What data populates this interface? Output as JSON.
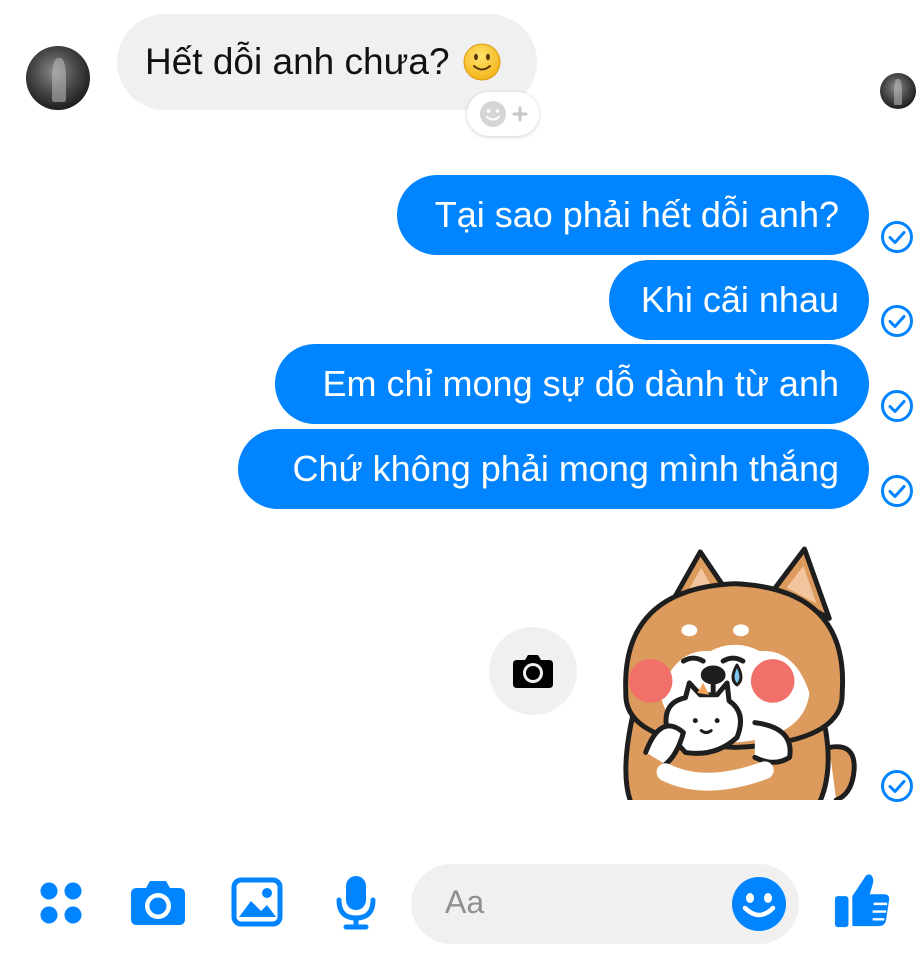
{
  "thread": {
    "received": {
      "text": "Hết dỗi anh chưa?",
      "emoji": "slightly-smiling-face",
      "reaction_button": "add-reaction-icon"
    },
    "sent": [
      {
        "text": "Tại sao phải hết dỗi anh?",
        "status": "sent-check-icon"
      },
      {
        "text": "Khi cãi nhau",
        "status": "sent-check-icon"
      },
      {
        "text": "Em chỉ mong sự dỗ dành từ anh",
        "status": "sent-check-icon"
      },
      {
        "text": "Chứ không phải mong mình thắng",
        "status": "sent-check-icon"
      }
    ],
    "sticker": {
      "name": "crying-shiba-dog-holding-cat-sticker",
      "status": "sent-check-icon"
    },
    "camera_shortcut": "camera-icon"
  },
  "composer": {
    "placeholder": "Aa",
    "tools": [
      "more-icon",
      "camera-icon",
      "photo-icon",
      "microphone-icon"
    ],
    "emoji_button": "smiley-icon",
    "like_button": "thumbs-up-icon"
  },
  "colors": {
    "accent": "#0084ff",
    "received_bubble": "#f1f0f0",
    "sent_text": "#ffffff"
  }
}
